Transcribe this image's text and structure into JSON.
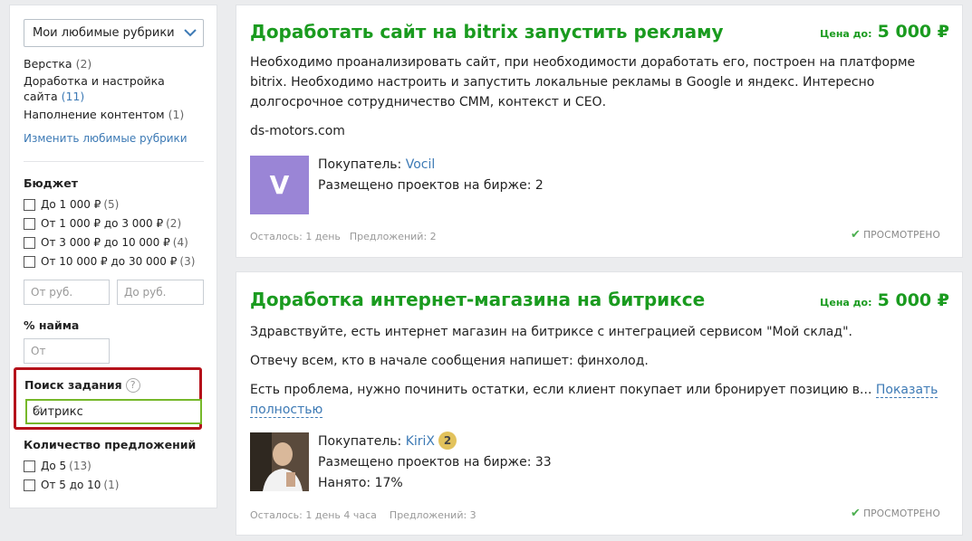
{
  "sidebar": {
    "dropdown": "Мои любимые рубрики",
    "categories": [
      {
        "label": "Верстка",
        "count": "(2)"
      },
      {
        "label": "Доработка и настройка сайта",
        "label_line1": "Доработка и настройка",
        "label_line2": "сайта",
        "count": "(11)"
      },
      {
        "label": "Наполнение контентом",
        "count": "(1)"
      }
    ],
    "edit_link": "Изменить любимые рубрики",
    "budget": {
      "title": "Бюджет",
      "options": [
        {
          "label": "До 1 000 ₽",
          "count": "(5)"
        },
        {
          "label": "От 1 000 ₽ до 3 000 ₽",
          "count": "(2)"
        },
        {
          "label": "От 3 000 ₽ до 10 000 ₽",
          "count": "(4)"
        },
        {
          "label": "От 10 000 ₽ до 30 000 ₽",
          "count": "(3)"
        }
      ],
      "from_placeholder": "От руб.",
      "to_placeholder": "До руб."
    },
    "hire": {
      "title": "% найма",
      "placeholder": "От"
    },
    "search": {
      "title": "Поиск задания",
      "help": "?",
      "value": "битрикс",
      "clear": "×"
    },
    "offers": {
      "title": "Количество предложений",
      "options": [
        {
          "label": "До 5",
          "count": "(13)"
        },
        {
          "label": "От 5 до 10",
          "count": "(1)"
        }
      ]
    }
  },
  "projects": [
    {
      "title": "Доработать сайт на bitrix запустить рекламу",
      "price_label": "Цена до:",
      "price": "5 000 ₽",
      "desc": [
        "Необходимо проанализировать сайт, при необходимости доработать его, построен на платформе bitrix. Необходимо настроить и запустить локальные рекламы в Google и яндекс. Интересно долгосрочное сотрудничество СММ, контекст и СЕО.",
        "ds-motors.com"
      ],
      "avatar_letter": "V",
      "buyer_label": "Покупатель:",
      "buyer": "Vocil",
      "placed": "Размещено проектов на бирже: 2",
      "time_left": "Осталось: 1 день",
      "offers": "Предложений: 2",
      "viewed": "ПРОСМОТРЕНО"
    },
    {
      "title": "Доработка интернет-магазина на битриксе",
      "price_label": "Цена до:",
      "price": "5 000 ₽",
      "desc": [
        "Здравствуйте, есть интернет магазин на битриксе с интеграцией сервисом \"Мой склад\".",
        "Отвечу всем, кто в начале сообщения напишет: финхолод.",
        "Есть проблема, нужно починить остатки, если клиент покупает или бронирует позицию в..."
      ],
      "show_more": "Показать полностью",
      "buyer_label": "Покупатель:",
      "buyer": "KiriX",
      "badge": "2",
      "placed": "Размещено проектов на бирже: 33",
      "hired": "Нанято: 17%",
      "time_left": "Осталось: 1 день 4 часа",
      "offers": "Предложений: 3",
      "viewed": "ПРОСМОТРЕНО"
    }
  ],
  "colors": {
    "accent_green": "#1a9b1f",
    "link_blue": "#3d7ab5",
    "highlight_red": "#b5121b"
  }
}
